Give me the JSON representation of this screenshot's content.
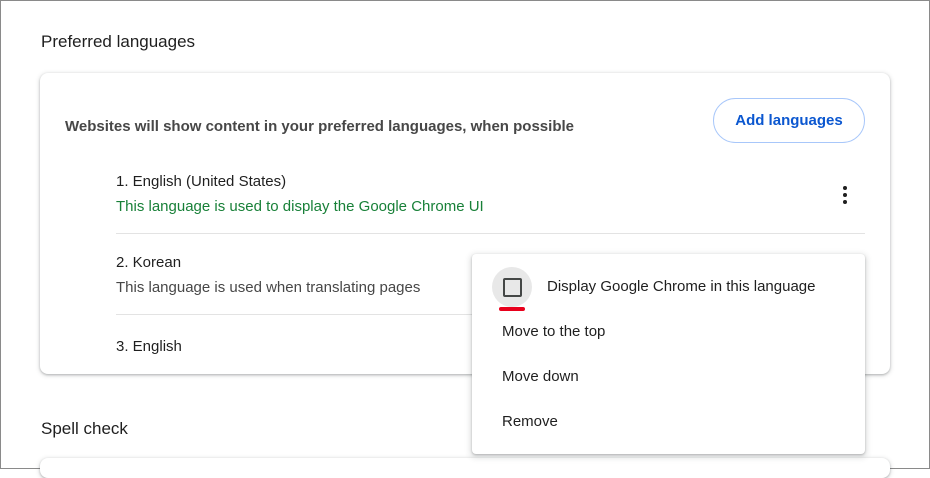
{
  "sections": {
    "preferred_languages_title": "Preferred languages",
    "spell_check_title": "Spell check"
  },
  "languages_card": {
    "description": "Websites will show content in your preferred languages, when possible",
    "add_button_label": "Add languages",
    "languages": [
      {
        "name": "1. English (United States)",
        "note": "This language is used to display the Google Chrome UI"
      },
      {
        "name": "2. Korean",
        "note": "This language is used when translating pages"
      },
      {
        "name": "3. English",
        "note": ""
      }
    ],
    "more_actions_icon": "vertical-ellipsis-icon"
  },
  "context_menu": {
    "checkbox_label": "Display Google Chrome in this language",
    "checkbox_checked": false,
    "items": [
      "Move to the top",
      "Move down",
      "Remove"
    ]
  },
  "colors": {
    "accent_blue": "#0b57d0",
    "ui_note_green": "#188038",
    "annotation_red": "#e8001c"
  }
}
